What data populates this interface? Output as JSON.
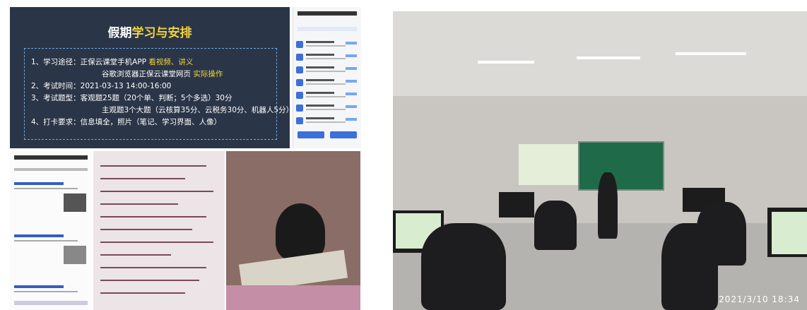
{
  "slide": {
    "title_prefix": "假期",
    "title_highlight": "学习与安排",
    "lines": [
      {
        "text": "1、学习途径：正保云课堂手机APP ",
        "highlight": "看视频、讲义"
      },
      {
        "text": "谷歌浏览器正保云课堂网页 ",
        "highlight": "实际操作"
      },
      {
        "text": "2、考试时间：2021-03-13 14:00-16:00",
        "highlight": ""
      },
      {
        "text": "3、考试题型：客观题25题（20个单、判断；5个多选）30分",
        "highlight": ""
      },
      {
        "text": "主观题3个大题（云核算35分、云税务30分、机器人5分）",
        "highlight": ""
      },
      {
        "text": "4、打卡要求：信息填全，照片（笔记、学习界面、人像）",
        "highlight": ""
      }
    ]
  },
  "photo": {
    "timestamp": "2021/3/10  18:34"
  },
  "colors": {
    "slide_bg": "#2b3548",
    "highlight": "#f2d43b",
    "board": "#1f6a48"
  }
}
